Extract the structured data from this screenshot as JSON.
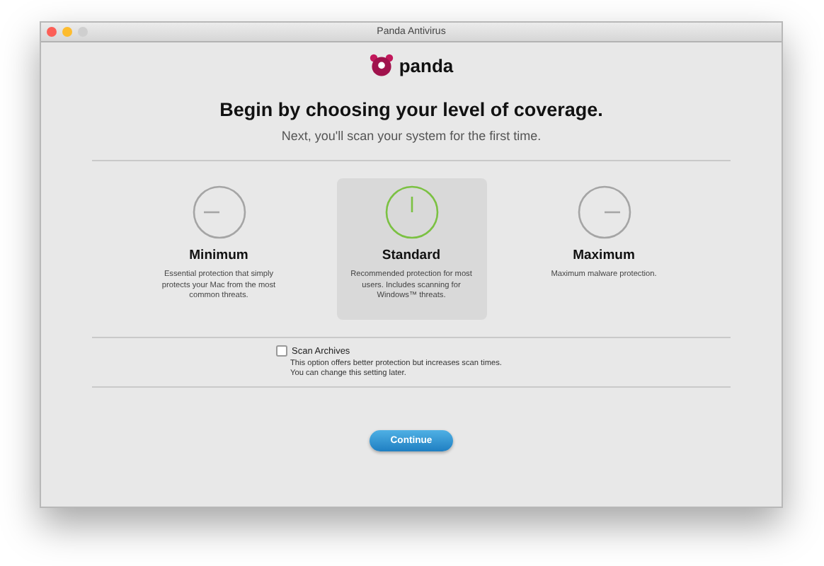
{
  "window": {
    "title": "Panda Antivirus"
  },
  "logo": {
    "text": "panda"
  },
  "heading": "Begin by choosing your level of coverage.",
  "subheading": "Next, you'll scan your system for the first time.",
  "options": [
    {
      "kind": "minimum",
      "title": "Minimum",
      "description": "Essential protection that simply protects your Mac from the most common threats.",
      "selected": false
    },
    {
      "kind": "standard",
      "title": "Standard",
      "description": "Recommended protection for most users. Includes scanning for Windows™ threats.",
      "selected": true
    },
    {
      "kind": "maximum",
      "title": "Maximum",
      "description": "Maximum malware protection.",
      "selected": false
    }
  ],
  "scan_archives": {
    "label": "Scan Archives",
    "checked": false,
    "description": "This option offers better protection but increases scan times.",
    "note": "You can change this setting later."
  },
  "continue_button": "Continue"
}
